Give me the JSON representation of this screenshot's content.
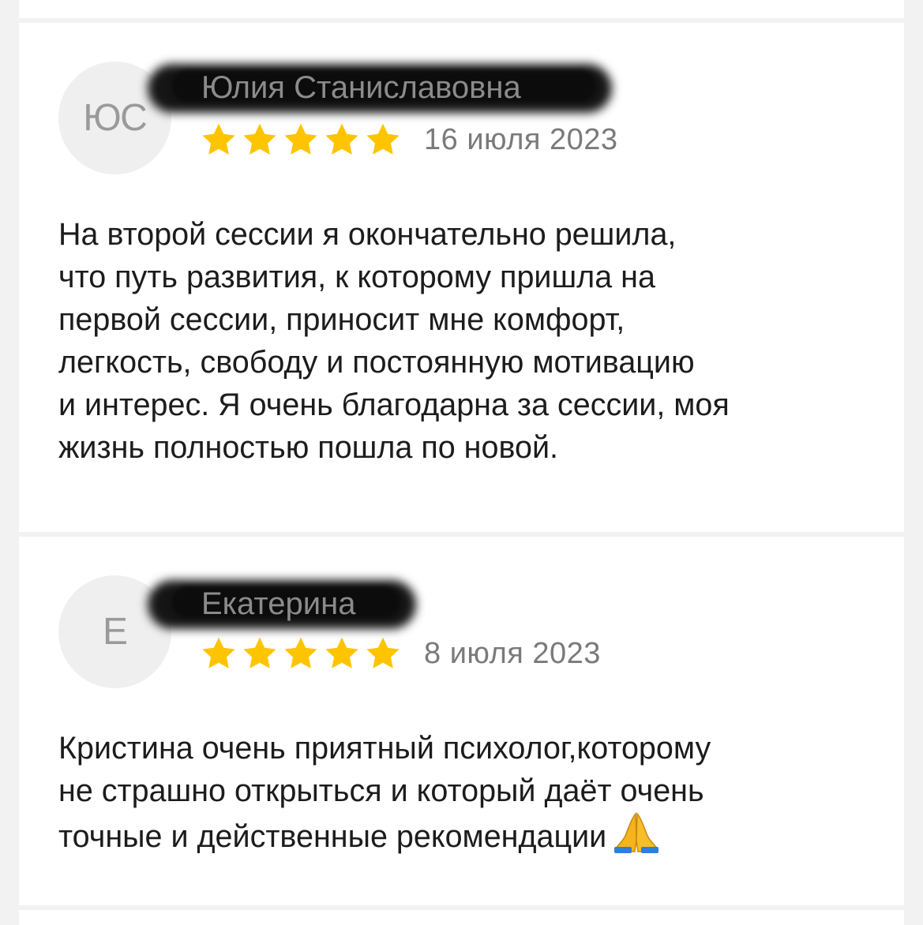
{
  "reviews": [
    {
      "initials": "ЮС",
      "name": "Юлия Станиславовна",
      "rating": 5,
      "max_rating": 5,
      "date": "16 июля 2023",
      "text": "На второй сессии я окончательно решила,\nчто путь развития, к которому пришла на\nпервой сессии, приносит мне комфорт,\nлегкость, свободу и постоянную мотивацию\nи интерес. Я очень благодарна за сессии, моя\nжизнь полностью пошла по новой."
    },
    {
      "initials": "Е",
      "name": "Екатерина",
      "rating": 5,
      "max_rating": 5,
      "date": "8 июля 2023",
      "text": "Кристина очень приятный психолог,которому\nне страшно открыться и который даёт очень\nточные и действенные рекомендации",
      "trailing_icon": "folded-hands-emoji"
    }
  ],
  "colors": {
    "star": "#FFC400",
    "avatar_bg": "#EFEFEF",
    "avatar_text": "#9A9A9A",
    "date_text": "#7A7A7A",
    "body_text": "#1C1C1C",
    "page_bg": "#F2F2F2",
    "card_bg": "#FFFFFF"
  }
}
